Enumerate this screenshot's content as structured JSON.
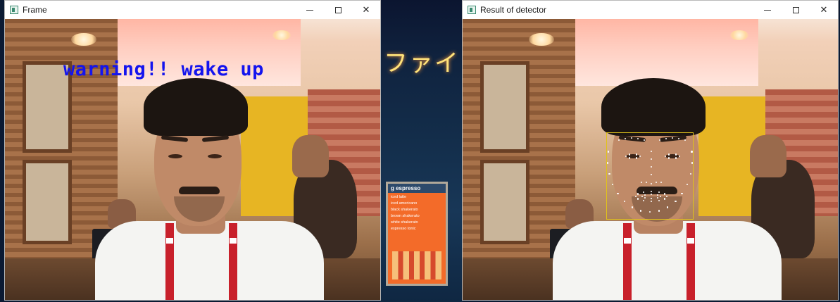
{
  "windows": {
    "frame": {
      "title": "Frame",
      "overlay_text": "warning!! wake up",
      "overlay_color": "#1414ee"
    },
    "detector": {
      "title": "Result of detector",
      "box_color": "#e0c21c",
      "landmark_color": "#ffffff"
    }
  },
  "controls": {
    "minimize_icon": "minimize-icon",
    "maximize_icon": "maximize-icon",
    "close_icon": "close-icon",
    "close_glyph": "✕"
  },
  "background": {
    "neon_sign": "ファイ",
    "menu_board": {
      "title": "g espresso",
      "items": [
        "iced latte",
        "iced americano",
        "black shakerato",
        "brown shakerato",
        "white shakerato",
        "espresso tonic"
      ]
    }
  }
}
